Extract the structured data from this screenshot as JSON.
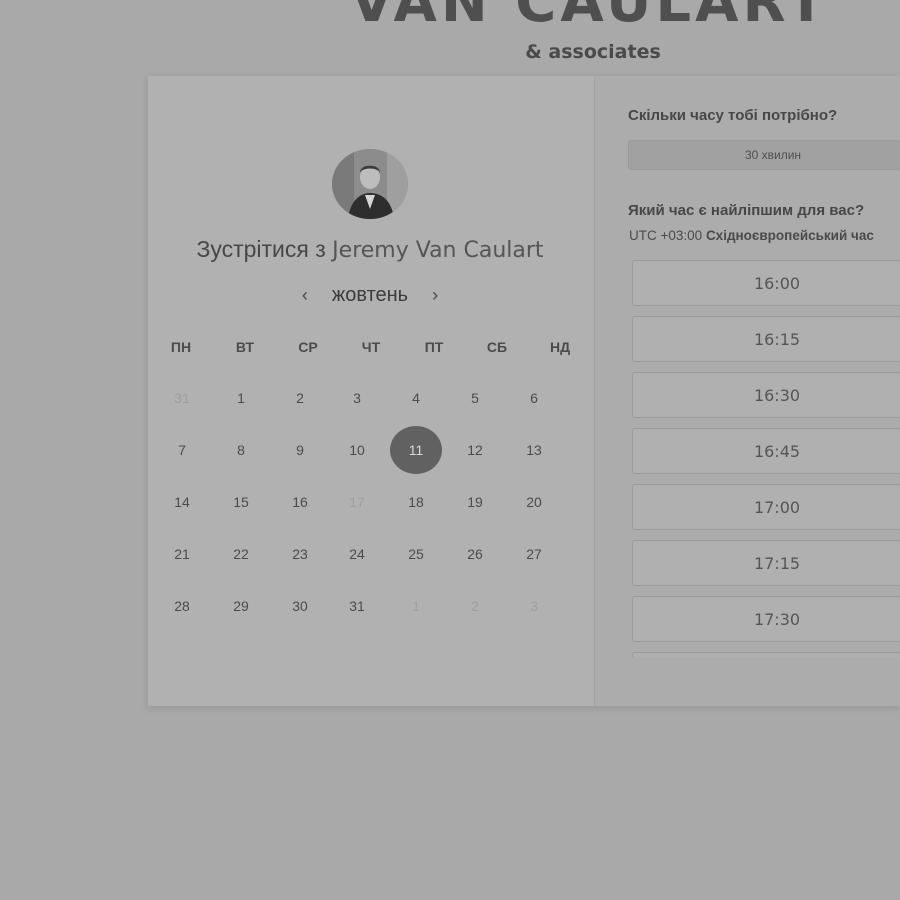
{
  "brand": {
    "name": "VAN CAULART",
    "tagline": "& associates"
  },
  "scheduler": {
    "title_prefix": "Зустрітися з",
    "host_name": "Jeremy Van Caulart",
    "month": "жовтень",
    "prev_icon": "chevron-left-icon",
    "next_icon": "chevron-right-icon",
    "weekdays": [
      "ПН",
      "ВТ",
      "СР",
      "ЧТ",
      "ПТ",
      "СБ",
      "НД"
    ],
    "weeks": [
      [
        {
          "d": "31",
          "s": "muted"
        },
        {
          "d": "1",
          "s": "normal"
        },
        {
          "d": "2",
          "s": "normal"
        },
        {
          "d": "3",
          "s": "normal"
        },
        {
          "d": "4",
          "s": "normal"
        },
        {
          "d": "5",
          "s": "normal"
        },
        {
          "d": "6",
          "s": "normal"
        }
      ],
      [
        {
          "d": "7",
          "s": "normal"
        },
        {
          "d": "8",
          "s": "normal"
        },
        {
          "d": "9",
          "s": "normal"
        },
        {
          "d": "10",
          "s": "normal"
        },
        {
          "d": "11",
          "s": "selected"
        },
        {
          "d": "12",
          "s": "normal"
        },
        {
          "d": "13",
          "s": "normal"
        }
      ],
      [
        {
          "d": "14",
          "s": "normal"
        },
        {
          "d": "15",
          "s": "normal"
        },
        {
          "d": "16",
          "s": "normal"
        },
        {
          "d": "17",
          "s": "muted"
        },
        {
          "d": "18",
          "s": "normal"
        },
        {
          "d": "19",
          "s": "normal"
        },
        {
          "d": "20",
          "s": "normal"
        }
      ],
      [
        {
          "d": "21",
          "s": "normal"
        },
        {
          "d": "22",
          "s": "normal"
        },
        {
          "d": "23",
          "s": "normal"
        },
        {
          "d": "24",
          "s": "normal"
        },
        {
          "d": "25",
          "s": "normal"
        },
        {
          "d": "26",
          "s": "normal"
        },
        {
          "d": "27",
          "s": "normal"
        }
      ],
      [
        {
          "d": "28",
          "s": "normal"
        },
        {
          "d": "29",
          "s": "normal"
        },
        {
          "d": "30",
          "s": "normal"
        },
        {
          "d": "31",
          "s": "normal"
        },
        {
          "d": "1",
          "s": "muted"
        },
        {
          "d": "2",
          "s": "muted"
        },
        {
          "d": "3",
          "s": "muted"
        }
      ]
    ]
  },
  "booking": {
    "duration_question": "Скільки часу тобі потрібно?",
    "duration_value": "30 хвилин",
    "time_question": "Який час є найліпшим для вас?",
    "tz_offset": "UTC +03:00",
    "tz_name": "Східноєвропейський час",
    "slots": [
      "16:00",
      "16:15",
      "16:30",
      "16:45",
      "17:00",
      "17:15",
      "17:30",
      ""
    ]
  },
  "colors": {
    "page_background": "#a9a9a9",
    "selected_day": "#616161"
  }
}
